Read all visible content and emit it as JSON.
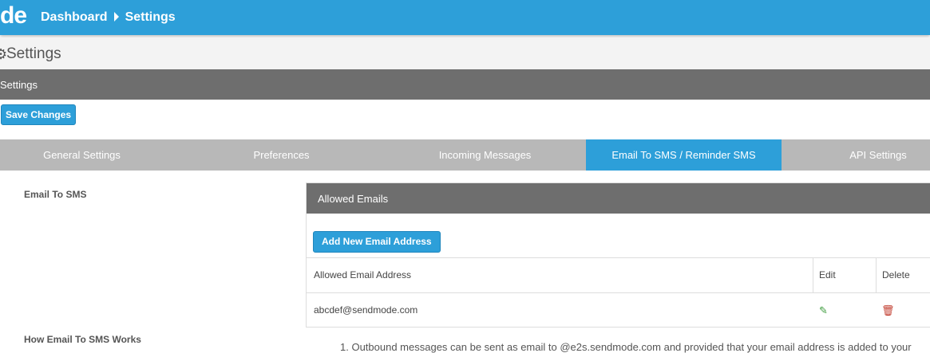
{
  "topbar": {
    "logo": "de",
    "breadcrumb": {
      "dashboard": "Dashboard",
      "settings": "Settings"
    }
  },
  "page": {
    "title": "Settings"
  },
  "panel": {
    "title": "Settings",
    "save_label": "Save Changes"
  },
  "tabs": [
    {
      "label": "General Settings",
      "active": false
    },
    {
      "label": "Preferences",
      "active": false
    },
    {
      "label": "Incoming Messages",
      "active": false
    },
    {
      "label": "Email To SMS / Reminder SMS",
      "active": true
    },
    {
      "label": "API Settings",
      "active": false
    }
  ],
  "email_to_sms": {
    "label": "Email To SMS",
    "allowed": {
      "title": "Allowed Emails",
      "add_label": "Add New Email Address",
      "columns": [
        "Allowed Email Address",
        "Edit",
        "Delete"
      ],
      "rows": [
        {
          "email": "abcdef@sendmode.com"
        }
      ]
    }
  },
  "how_it_works": {
    "label": "How Email To SMS Works",
    "text": "1. Outbound messages can be sent as email to @e2s.sendmode.com and provided that your email address is added to your"
  },
  "icons": {
    "settings": "gear-icon",
    "edit": "edit-icon",
    "delete": "trash-icon"
  },
  "colors": {
    "accent": "#2d9fd9",
    "header_gray": "#6e6e6e",
    "tab_gray": "#b8b8b8"
  }
}
